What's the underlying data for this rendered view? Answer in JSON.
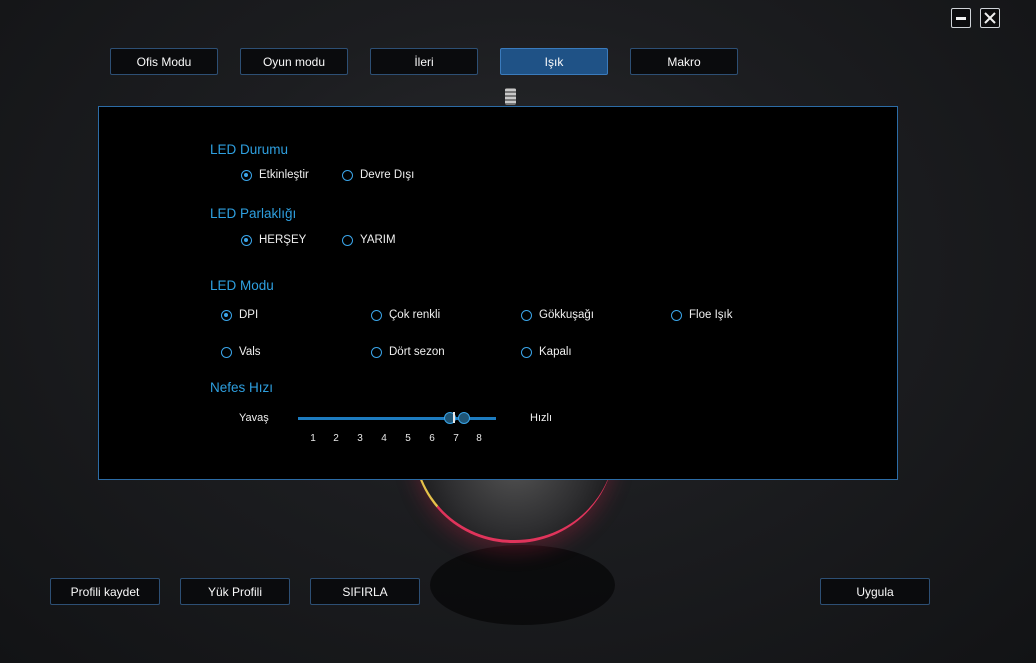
{
  "tabs": [
    {
      "label": "Ofis Modu"
    },
    {
      "label": "Oyun modu"
    },
    {
      "label": "İleri"
    },
    {
      "label": "Işık",
      "active": true
    },
    {
      "label": "Makro"
    }
  ],
  "led_status": {
    "heading": "LED Durumu",
    "options": [
      {
        "label": "Etkinleştir",
        "checked": true
      },
      {
        "label": "Devre Dışı",
        "checked": false
      }
    ]
  },
  "led_brightness": {
    "heading": "LED Parlaklığı",
    "options": [
      {
        "label": "HERŞEY",
        "checked": true
      },
      {
        "label": "YARIM",
        "checked": false
      }
    ]
  },
  "led_mode": {
    "heading": "LED Modu",
    "options": [
      {
        "label": "DPI",
        "checked": true
      },
      {
        "label": "Çok renkli",
        "checked": false
      },
      {
        "label": "Gökkuşağı",
        "checked": false
      },
      {
        "label": "Floe Işık",
        "checked": false
      },
      {
        "label": "Vals",
        "checked": false
      },
      {
        "label": "Dört sezon",
        "checked": false
      },
      {
        "label": "Kapalı",
        "checked": false
      }
    ]
  },
  "breath_speed": {
    "heading": "Nefes Hızı",
    "slow_label": "Yavaş",
    "fast_label": "Hızlı",
    "ticks": [
      "1",
      "2",
      "3",
      "4",
      "5",
      "6",
      "7",
      "8"
    ],
    "value": 7
  },
  "bottom_buttons": {
    "save_profile": "Profili kaydet",
    "load_profile": "Yük Profili",
    "reset": "SIFIRLA",
    "apply": "Uygula"
  },
  "colors": {
    "accent": "#2e9fdf",
    "active_tab": "#1f5286",
    "panel_border": "#2c6ca6"
  }
}
